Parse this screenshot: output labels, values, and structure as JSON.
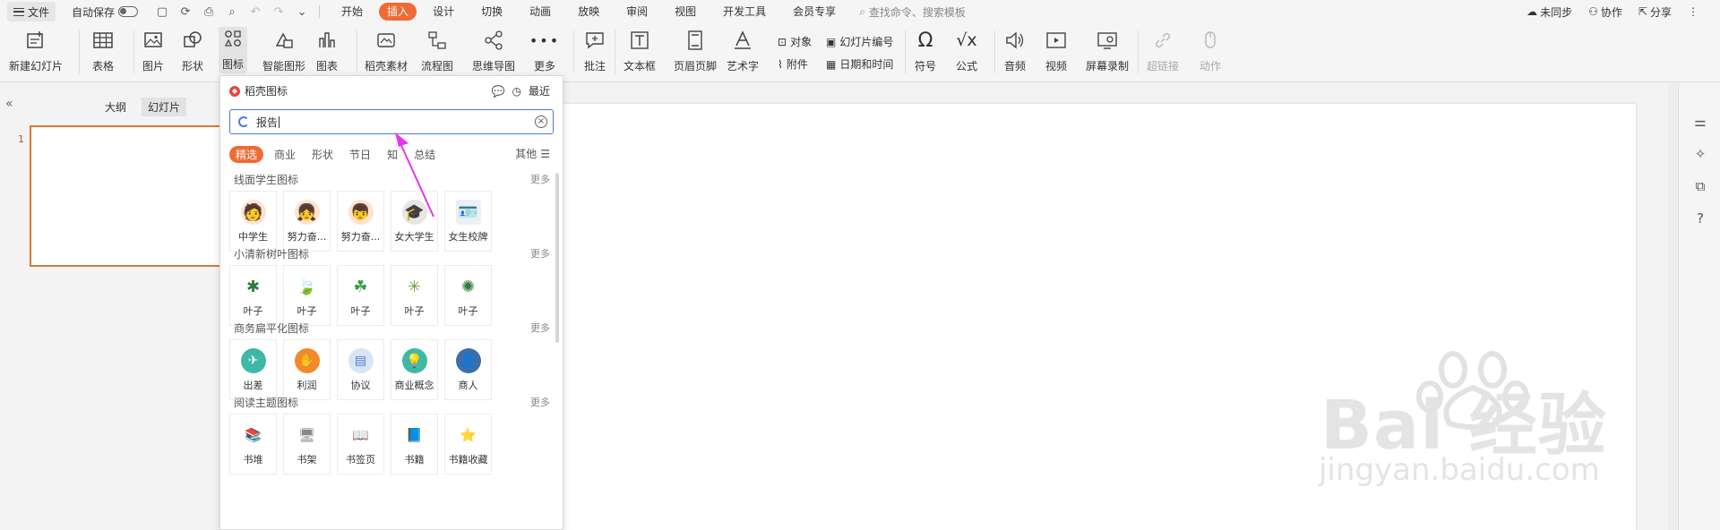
{
  "menubar": {
    "file_label": "文件",
    "autosave_label": "自动保存",
    "tabs": [
      "开始",
      "插入",
      "设计",
      "切换",
      "动画",
      "放映",
      "审阅",
      "视图",
      "开发工具",
      "会员专享"
    ],
    "active_tab": "插入",
    "search_placeholder": "查找命令、搜索模板",
    "unsynced_label": "未同步",
    "collab_label": "协作",
    "share_label": "分享"
  },
  "ribbon": {
    "new_slide": "新建幻灯片",
    "table": "表格",
    "picture": "图片",
    "shape": "形状",
    "icon": "图标",
    "smart_graphic": "智能图形",
    "chart": "图表",
    "docer_material": "稻壳素材",
    "flowchart": "流程图",
    "mindmap": "思维导图",
    "more": "更多",
    "comment": "批注",
    "textbox": "文本框",
    "header_footer": "页眉页脚",
    "wordart": "艺术字",
    "object": "对象",
    "attachment": "附件",
    "slide_number": "幻灯片编号",
    "date_time": "日期和时间",
    "symbol": "符号",
    "formula": "公式",
    "audio": "音频",
    "video": "视频",
    "screen_record": "屏幕录制",
    "hyperlink": "超链接",
    "action": "动作"
  },
  "leftpane": {
    "outline_tab": "大纲",
    "slides_tab": "幻灯片",
    "slide_number": "1"
  },
  "icon_panel": {
    "title": "稻壳图标",
    "recent_label": "最近",
    "search_value": "报告",
    "categories": [
      "精选",
      "商业",
      "形状",
      "节日",
      "知",
      "总结"
    ],
    "active_category": "精选",
    "other_label": "其他",
    "more_label": "更多",
    "sections": [
      {
        "title": "线面学生图标",
        "items": [
          "中学生",
          "努力奋...",
          "努力奋...",
          "女大学生",
          "女生校牌"
        ]
      },
      {
        "title": "小清新树叶图标",
        "items": [
          "叶子",
          "叶子",
          "叶子",
          "叶子",
          "叶子"
        ]
      },
      {
        "title": "商务扁平化图标",
        "items": [
          "出差",
          "利润",
          "协议",
          "商业概念",
          "商人"
        ]
      },
      {
        "title": "阅读主题图标",
        "items": [
          "书堆",
          "书架",
          "书签页",
          "书籍",
          "书籍收藏"
        ]
      }
    ]
  },
  "watermark": {
    "brand": "Bai   经验",
    "url": "jingyan.baidu.com"
  },
  "colors": {
    "accent": "#f06a34",
    "focus": "#4a7bd6",
    "arrow": "#e535e8",
    "thumb_border": "#d9792f"
  }
}
